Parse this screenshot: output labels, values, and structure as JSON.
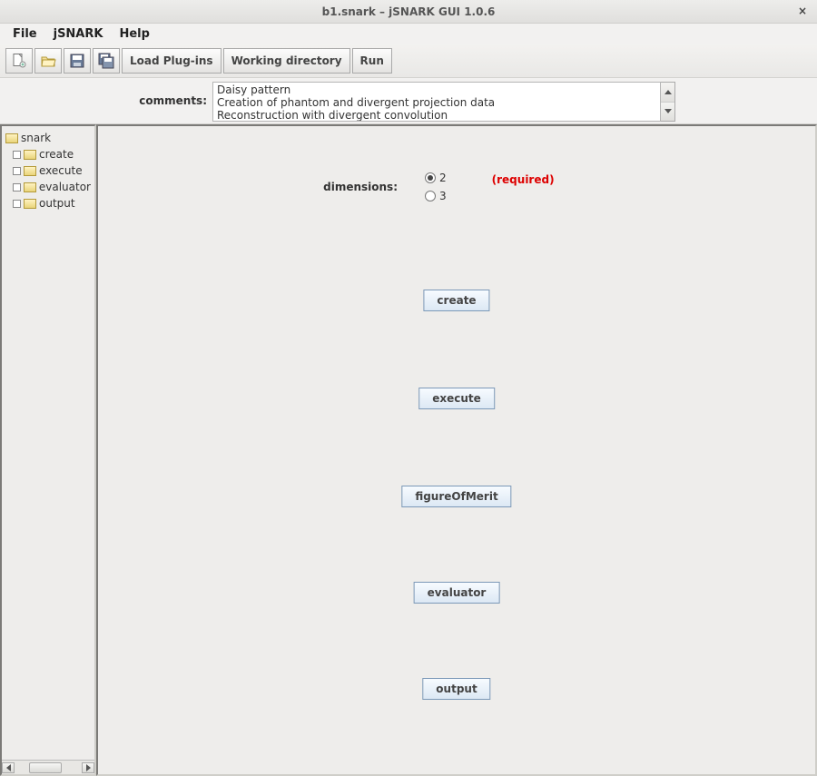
{
  "window": {
    "title": "b1.snark – jSNARK GUI 1.0.6",
    "close_glyph": "×"
  },
  "menubar": {
    "file": "File",
    "jsnark": "jSNARK",
    "help": "Help"
  },
  "toolbar": {
    "new": "new-file",
    "open": "open-file",
    "save": "save-file",
    "saveAs": "save-as",
    "loadPlugins": "Load Plug-ins",
    "workingDirectory": "Working directory",
    "run": "Run"
  },
  "comments": {
    "label": "comments:",
    "lines": {
      "l0": "Daisy pattern",
      "l1": "Creation of phantom and divergent projection data",
      "l2": "Reconstruction with divergent convolution"
    }
  },
  "tree": {
    "root": "snark",
    "children": {
      "c0": "create",
      "c1": "execute",
      "c2": "evaluator",
      "c3": "output"
    }
  },
  "form": {
    "dimensions_label": "dimensions:",
    "dim2": "2",
    "dim3": "3",
    "dim_selected": "2",
    "required": "(required)"
  },
  "buttons": {
    "create": "create",
    "execute": "execute",
    "figureOfMerit": "figureOfMerit",
    "evaluator": "evaluator",
    "output": "output"
  }
}
